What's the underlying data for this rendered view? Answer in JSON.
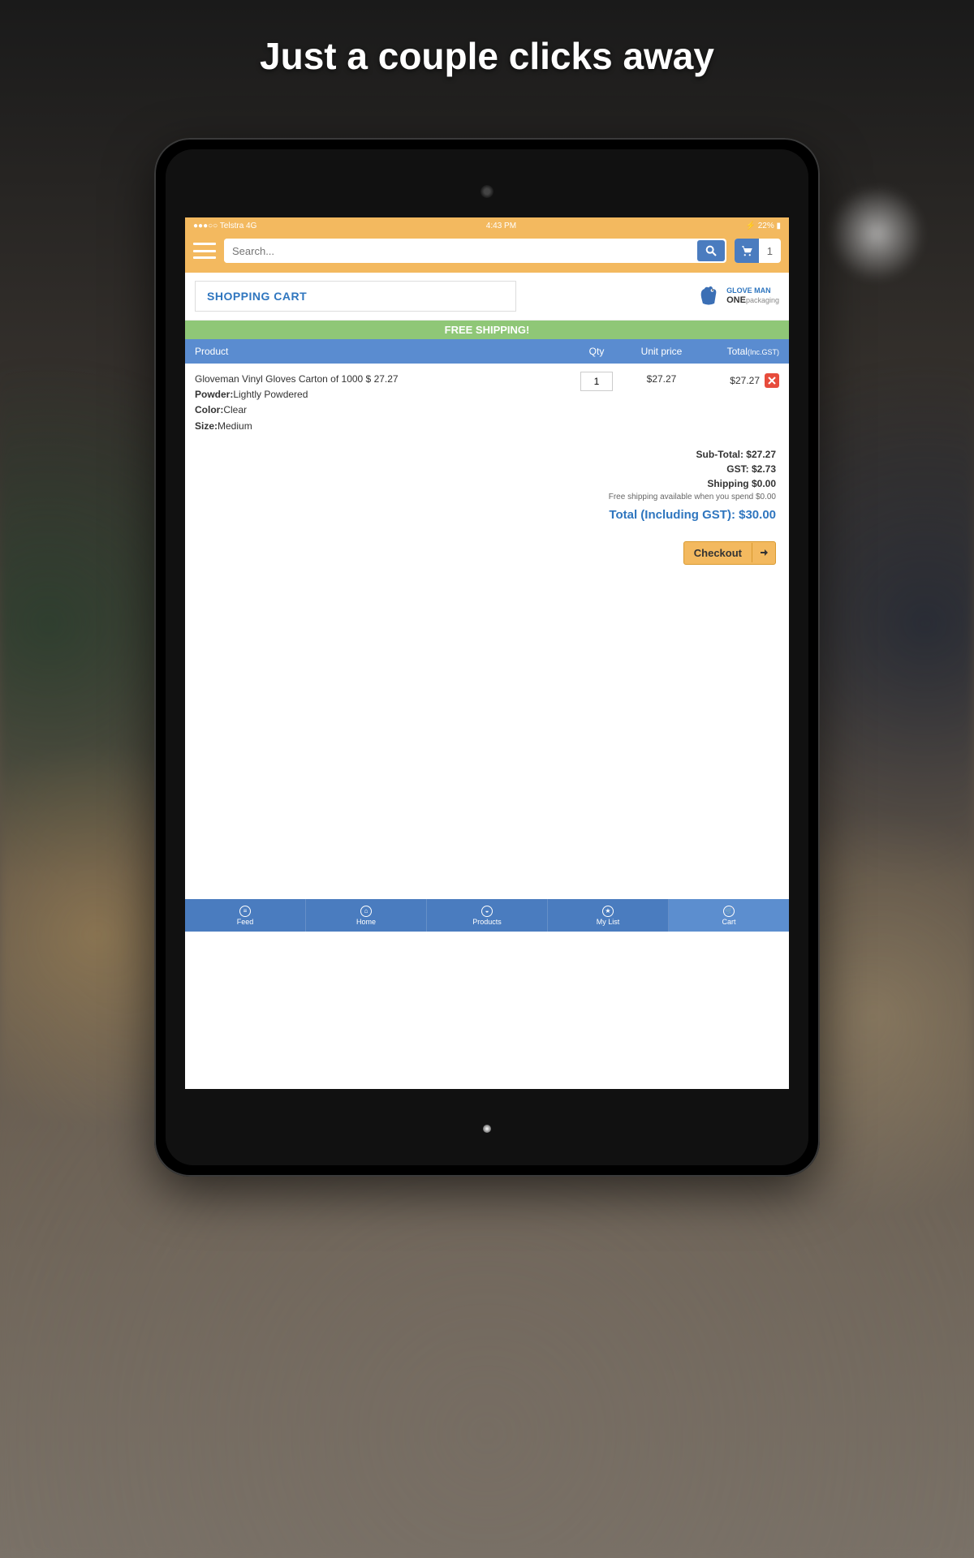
{
  "hero": {
    "title": "Just a couple clicks away"
  },
  "statusbar": {
    "carrier": "●●●○○ Telstra  4G",
    "time": "4:43 PM",
    "battery": "⚡ 22% ▮"
  },
  "header": {
    "search_placeholder": "Search...",
    "cart_count": "1"
  },
  "page_title": "SHOPPING CART",
  "brand": {
    "line1": "GLOVE MAN",
    "line2": "ONE",
    "line3": "packaging"
  },
  "banner": "FREE SHIPPING!",
  "table": {
    "headers": {
      "product": "Product",
      "qty": "Qty",
      "unit": "Unit price",
      "total": "Total",
      "total_suffix": "(Inc.GST)"
    },
    "row": {
      "name": "Gloveman Vinyl Gloves Carton of 1000 $ 27.27",
      "powder_label": "Powder:",
      "powder": "Lightly Powdered",
      "color_label": "Color:",
      "color": "Clear",
      "size_label": "Size:",
      "size": "Medium",
      "qty": "1",
      "unit_price": "$27.27",
      "line_total": "$27.27"
    }
  },
  "totals": {
    "subtotal": "Sub-Total: $27.27",
    "gst": "GST: $2.73",
    "shipping": "Shipping $0.00",
    "note": "Free shipping available when you spend $0.00",
    "grand": "Total (Including GST): $30.00"
  },
  "checkout_label": "Checkout",
  "nav": {
    "items": [
      {
        "label": "Feed"
      },
      {
        "label": "Home"
      },
      {
        "label": "Products"
      },
      {
        "label": "My List"
      },
      {
        "label": "Cart"
      }
    ]
  }
}
